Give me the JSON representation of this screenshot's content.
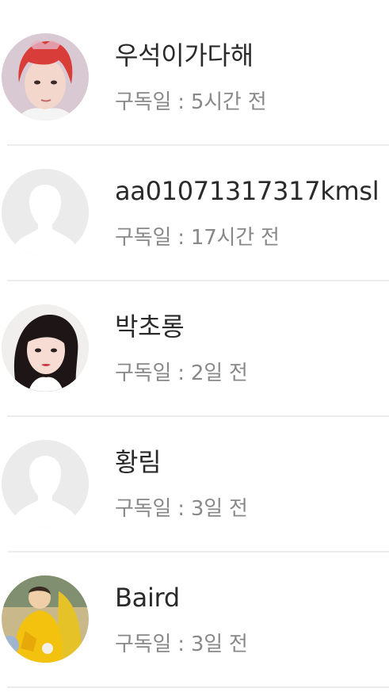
{
  "subscribers": [
    {
      "name": "우석이가다해",
      "subscribed": "구독일 : 5시간 전",
      "avatar_icon": "profile-photo-red-hair"
    },
    {
      "name": "aa01071317317kmsl",
      "subscribed": "구독일 : 17시간 전",
      "avatar_icon": "default-avatar-icon"
    },
    {
      "name": "박초롱",
      "subscribed": "구독일 : 2일 전",
      "avatar_icon": "profile-photo-woman"
    },
    {
      "name": "황림",
      "subscribed": "구독일 : 3일 전",
      "avatar_icon": "default-avatar-icon"
    },
    {
      "name": "Baird",
      "subscribed": "구독일 : 3일 전",
      "avatar_icon": "profile-photo-child-yellow"
    }
  ]
}
